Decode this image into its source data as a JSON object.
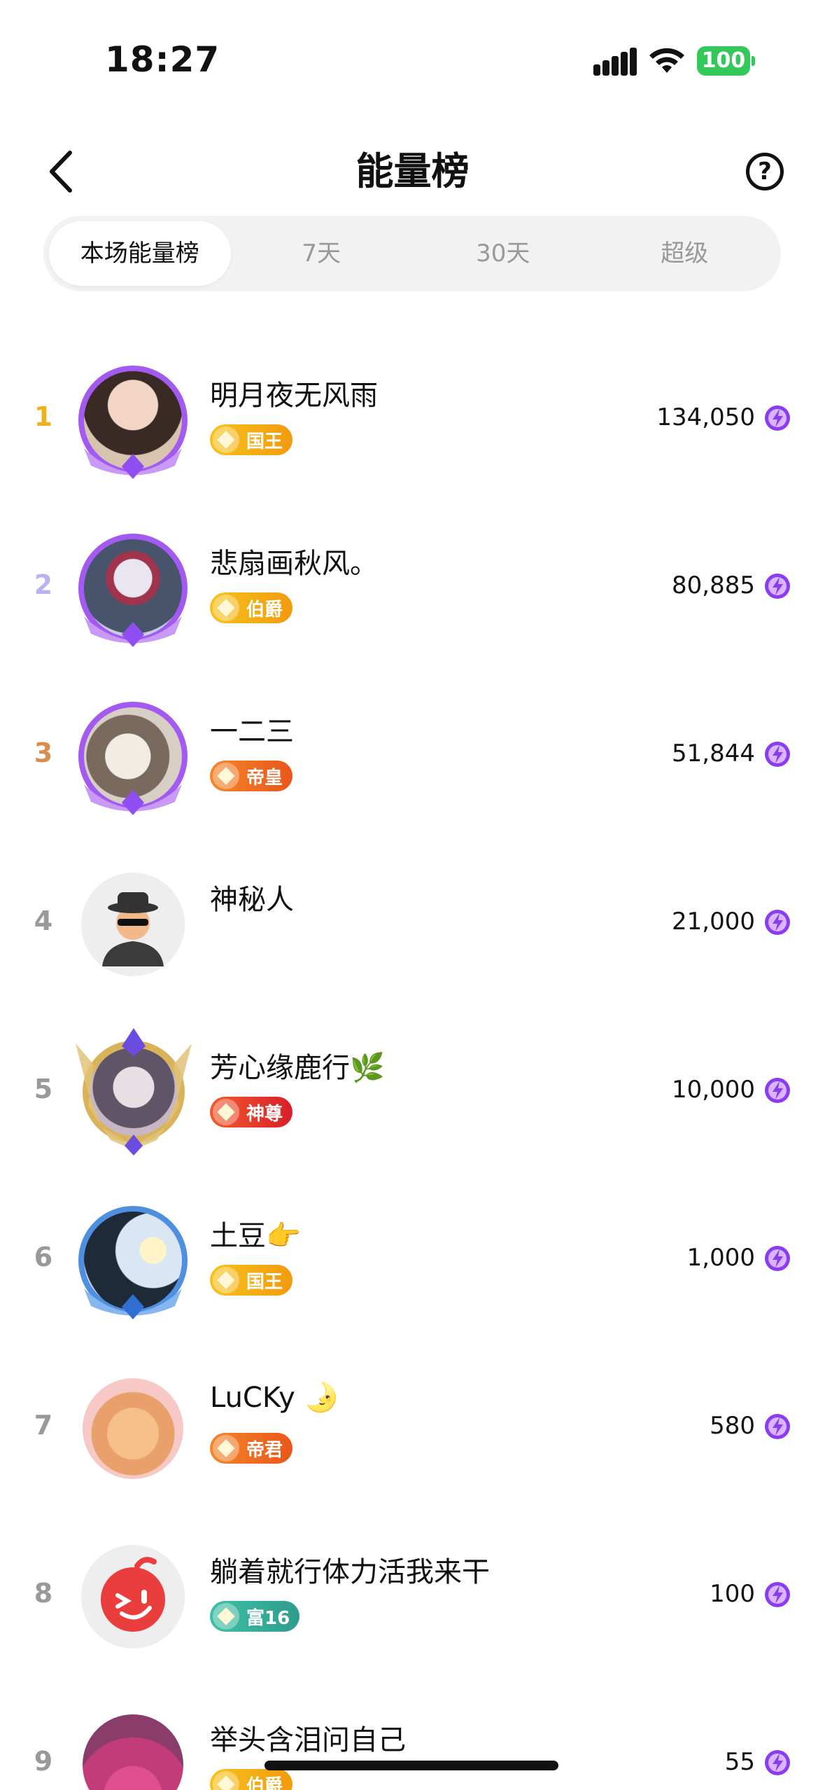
{
  "status_bar": {
    "time": "18:27",
    "battery": "100"
  },
  "header": {
    "title": "能量榜",
    "help": "?"
  },
  "tabs": [
    {
      "label": "本场能量榜",
      "active": true
    },
    {
      "label": "7天",
      "active": false
    },
    {
      "label": "30天",
      "active": false
    },
    {
      "label": "超级",
      "active": false
    }
  ],
  "rows": [
    {
      "rank": "1",
      "name": "明月夜无风雨",
      "badge": "国王",
      "score": "134,050"
    },
    {
      "rank": "2",
      "name": "悲扇画秋风。",
      "badge": "伯爵",
      "score": "80,885"
    },
    {
      "rank": "3",
      "name": "一二三",
      "badge": "帝皇",
      "score": "51,844"
    },
    {
      "rank": "4",
      "name": "神秘人",
      "badge": "",
      "score": "21,000"
    },
    {
      "rank": "5",
      "name": "芳心缘鹿行🌿",
      "badge": "神尊",
      "score": "10,000"
    },
    {
      "rank": "6",
      "name": "土豆👉",
      "badge": "国王",
      "score": "1,000"
    },
    {
      "rank": "7",
      "name": "LuCKy 🌛",
      "badge": "帝君",
      "score": "580"
    },
    {
      "rank": "8",
      "name": "躺着就行体力活我来干",
      "badge": "富16",
      "score": "100"
    },
    {
      "rank": "9",
      "name": "举头含泪问自己",
      "badge": "伯爵",
      "score": "55"
    }
  ],
  "colors": {
    "rank1": "#f0b21c",
    "rank2": "#b7b3ef",
    "rank3": "#d98c4b",
    "rank_other": "#9b9b9b",
    "badge_gold": "#f2a60f",
    "badge_orange": "#f26b1d",
    "badge_red": "#e8302f",
    "badge_teal": "#36b39a",
    "energy": "#8b3cf0"
  }
}
